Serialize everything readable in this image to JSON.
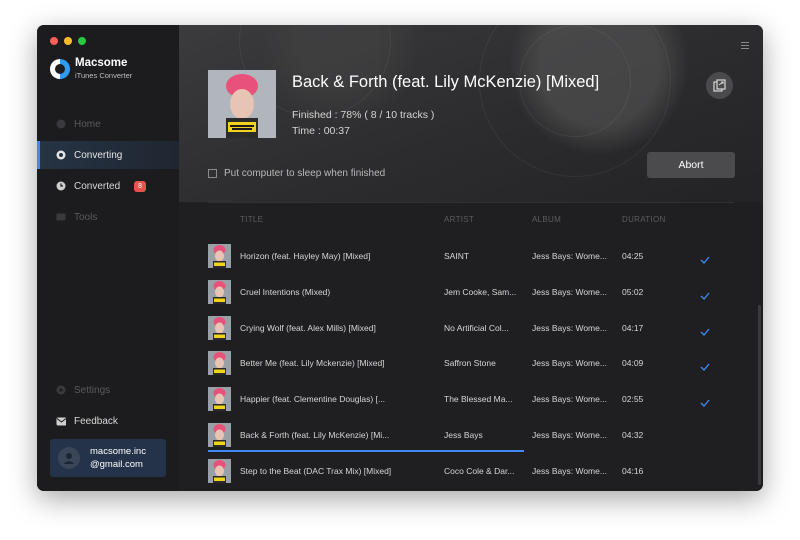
{
  "app": {
    "name": "Macsome",
    "subtitle": "iTunes Converter"
  },
  "nav": {
    "home": "Home",
    "converting": "Converting",
    "converted": "Converted",
    "converted_badge": "8",
    "tools": "Tools",
    "settings": "Settings",
    "feedback": "Feedback"
  },
  "account": {
    "line1": "macsome.inc",
    "line2": "@gmail.com"
  },
  "now": {
    "title": "Back & Forth (feat. Lily McKenzie) [Mixed]",
    "status": "Finished : 78% ( 8 / 10 tracks )",
    "time": "Time :  00:37",
    "progress_percent": 78
  },
  "controls": {
    "abort": "Abort",
    "sleep_label": "Put computer to sleep when finished",
    "sleep_checked": false
  },
  "table": {
    "headers": {
      "title": "TITLE",
      "artist": "ARTIST",
      "album": "ALBUM",
      "duration": "DURATION"
    },
    "rows": [
      {
        "title": "Horizon (feat. Hayley May) [Mixed]",
        "artist": "SAINT",
        "album": "Jess Bays: Wome...",
        "duration": "04:25",
        "done": true
      },
      {
        "title": "Cruel Intentions (Mixed)",
        "artist": "Jem Cooke, Sam...",
        "album": "Jess Bays: Wome...",
        "duration": "05:02",
        "done": true
      },
      {
        "title": "Crying Wolf (feat. Alex Mills) [Mixed]",
        "artist": "No Artificial Col...",
        "album": "Jess Bays: Wome...",
        "duration": "04:17",
        "done": true
      },
      {
        "title": "Better Me (feat. Lily Mckenzie) [Mixed]",
        "artist": "Saffron Stone",
        "album": "Jess Bays: Wome...",
        "duration": "04:09",
        "done": true
      },
      {
        "title": "Happier (feat. Clementine Douglas) [...",
        "artist": "The Blessed Ma...",
        "album": "Jess Bays: Wome...",
        "duration": "02:55",
        "done": true
      },
      {
        "title": "Back & Forth (feat. Lily McKenzie) [Mi...",
        "artist": "Jess Bays",
        "album": "Jess Bays: Wome...",
        "duration": "04:32",
        "done": false,
        "progress": 0.6
      },
      {
        "title": "Step to the Beat (DAC Trax Mix) [Mixed]",
        "artist": "Coco Cole & Dar...",
        "album": "Jess Bays: Wome...",
        "duration": "04:16",
        "done": false
      }
    ]
  },
  "colors": {
    "accent": "#3d8bf0",
    "badge": "#e5534b",
    "cover_pink": "#e8527a",
    "cover_yellow": "#f2d21b"
  }
}
